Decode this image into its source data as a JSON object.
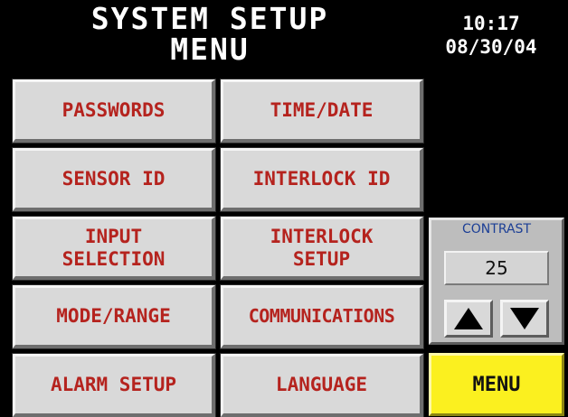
{
  "header": {
    "title_line1": "SYSTEM SETUP",
    "title_line2": "MENU",
    "time": "10:17",
    "date": "08/30/04"
  },
  "buttons": {
    "passwords": "PASSWORDS",
    "time_date": "TIME/DATE",
    "sensor_id": "SENSOR ID",
    "interlock_id": "INTERLOCK ID",
    "input_selection": "INPUT\nSELECTION",
    "interlock_setup": "INTERLOCK\nSETUP",
    "mode_range": "MODE/RANGE",
    "communications": "COMMUNICATIONS",
    "alarm_setup": "ALARM SETUP",
    "language": "LANGUAGE"
  },
  "contrast": {
    "label": "CONTRAST",
    "value": "25",
    "up_icon": "arrow-up-icon",
    "down_icon": "arrow-down-icon"
  },
  "menu_button": "MENU",
  "colors": {
    "background": "#000000",
    "button_face": "#d9d9d9",
    "button_text": "#b5231e",
    "menu_button": "#fbf01f",
    "contrast_label": "#1c3f96"
  }
}
